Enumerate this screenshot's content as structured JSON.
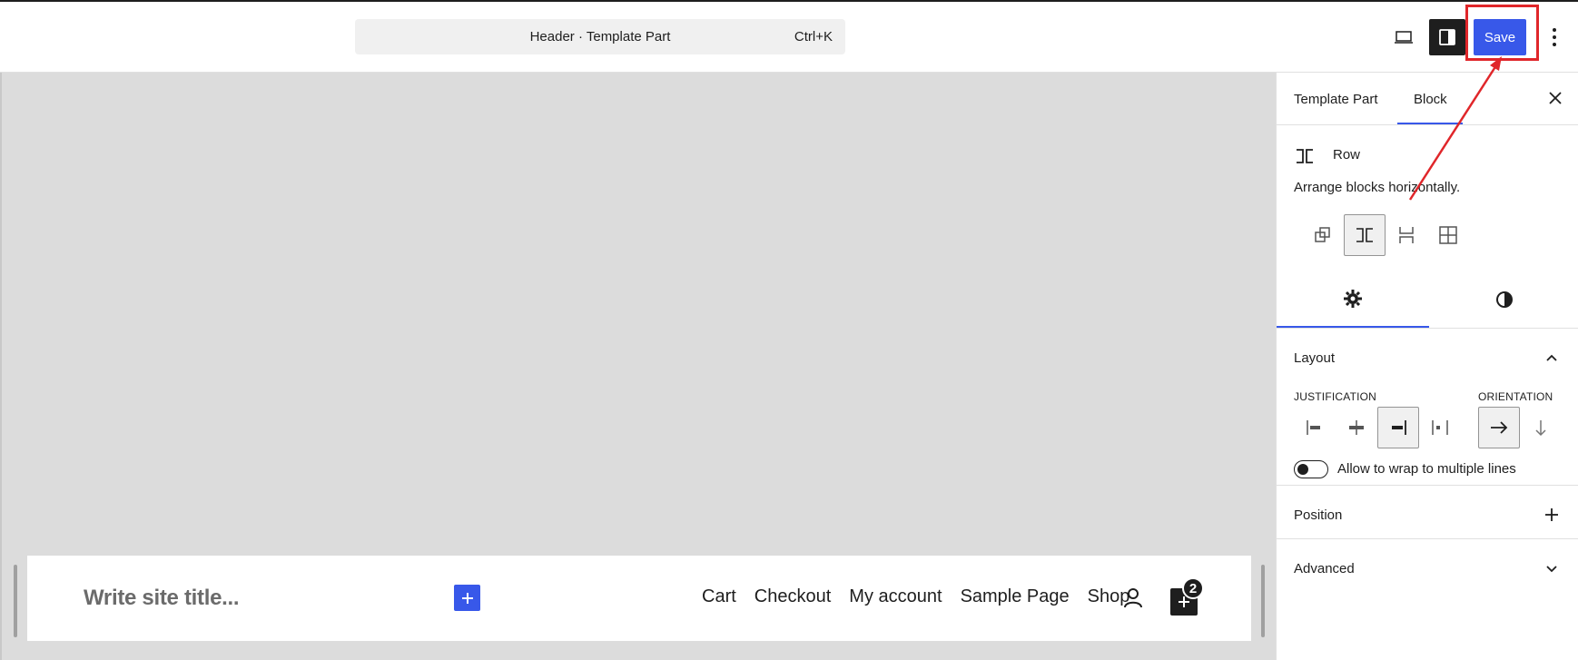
{
  "topbar": {
    "command_title": "Header · Template Part",
    "command_shortcut": "Ctrl+K",
    "save_label": "Save",
    "icons": {
      "laptop": "laptop-icon",
      "sidebar": "sidebar-toggle-icon",
      "kebab": "kebab-menu-icon"
    }
  },
  "canvas": {
    "site_title_placeholder": "Write site title...",
    "nav_items": [
      "Cart",
      "Checkout",
      "My account",
      "Sample Page",
      "Shop"
    ],
    "cart_count": "2"
  },
  "sidebar": {
    "tabs": [
      "Template Part",
      "Block"
    ],
    "active_tab": "Block",
    "block_name": "Row",
    "block_description": "Arrange blocks horizontally.",
    "layout": {
      "title": "Layout",
      "justification_label": "JUSTIFICATION",
      "orientation_label": "ORIENTATION",
      "wrap_label": "Allow to wrap to multiple lines"
    },
    "position_title": "Position",
    "advanced_title": "Advanced"
  },
  "colors": {
    "accent": "#3858e9",
    "annotation": "#e0262a",
    "canvas": "#dcdcdc"
  }
}
